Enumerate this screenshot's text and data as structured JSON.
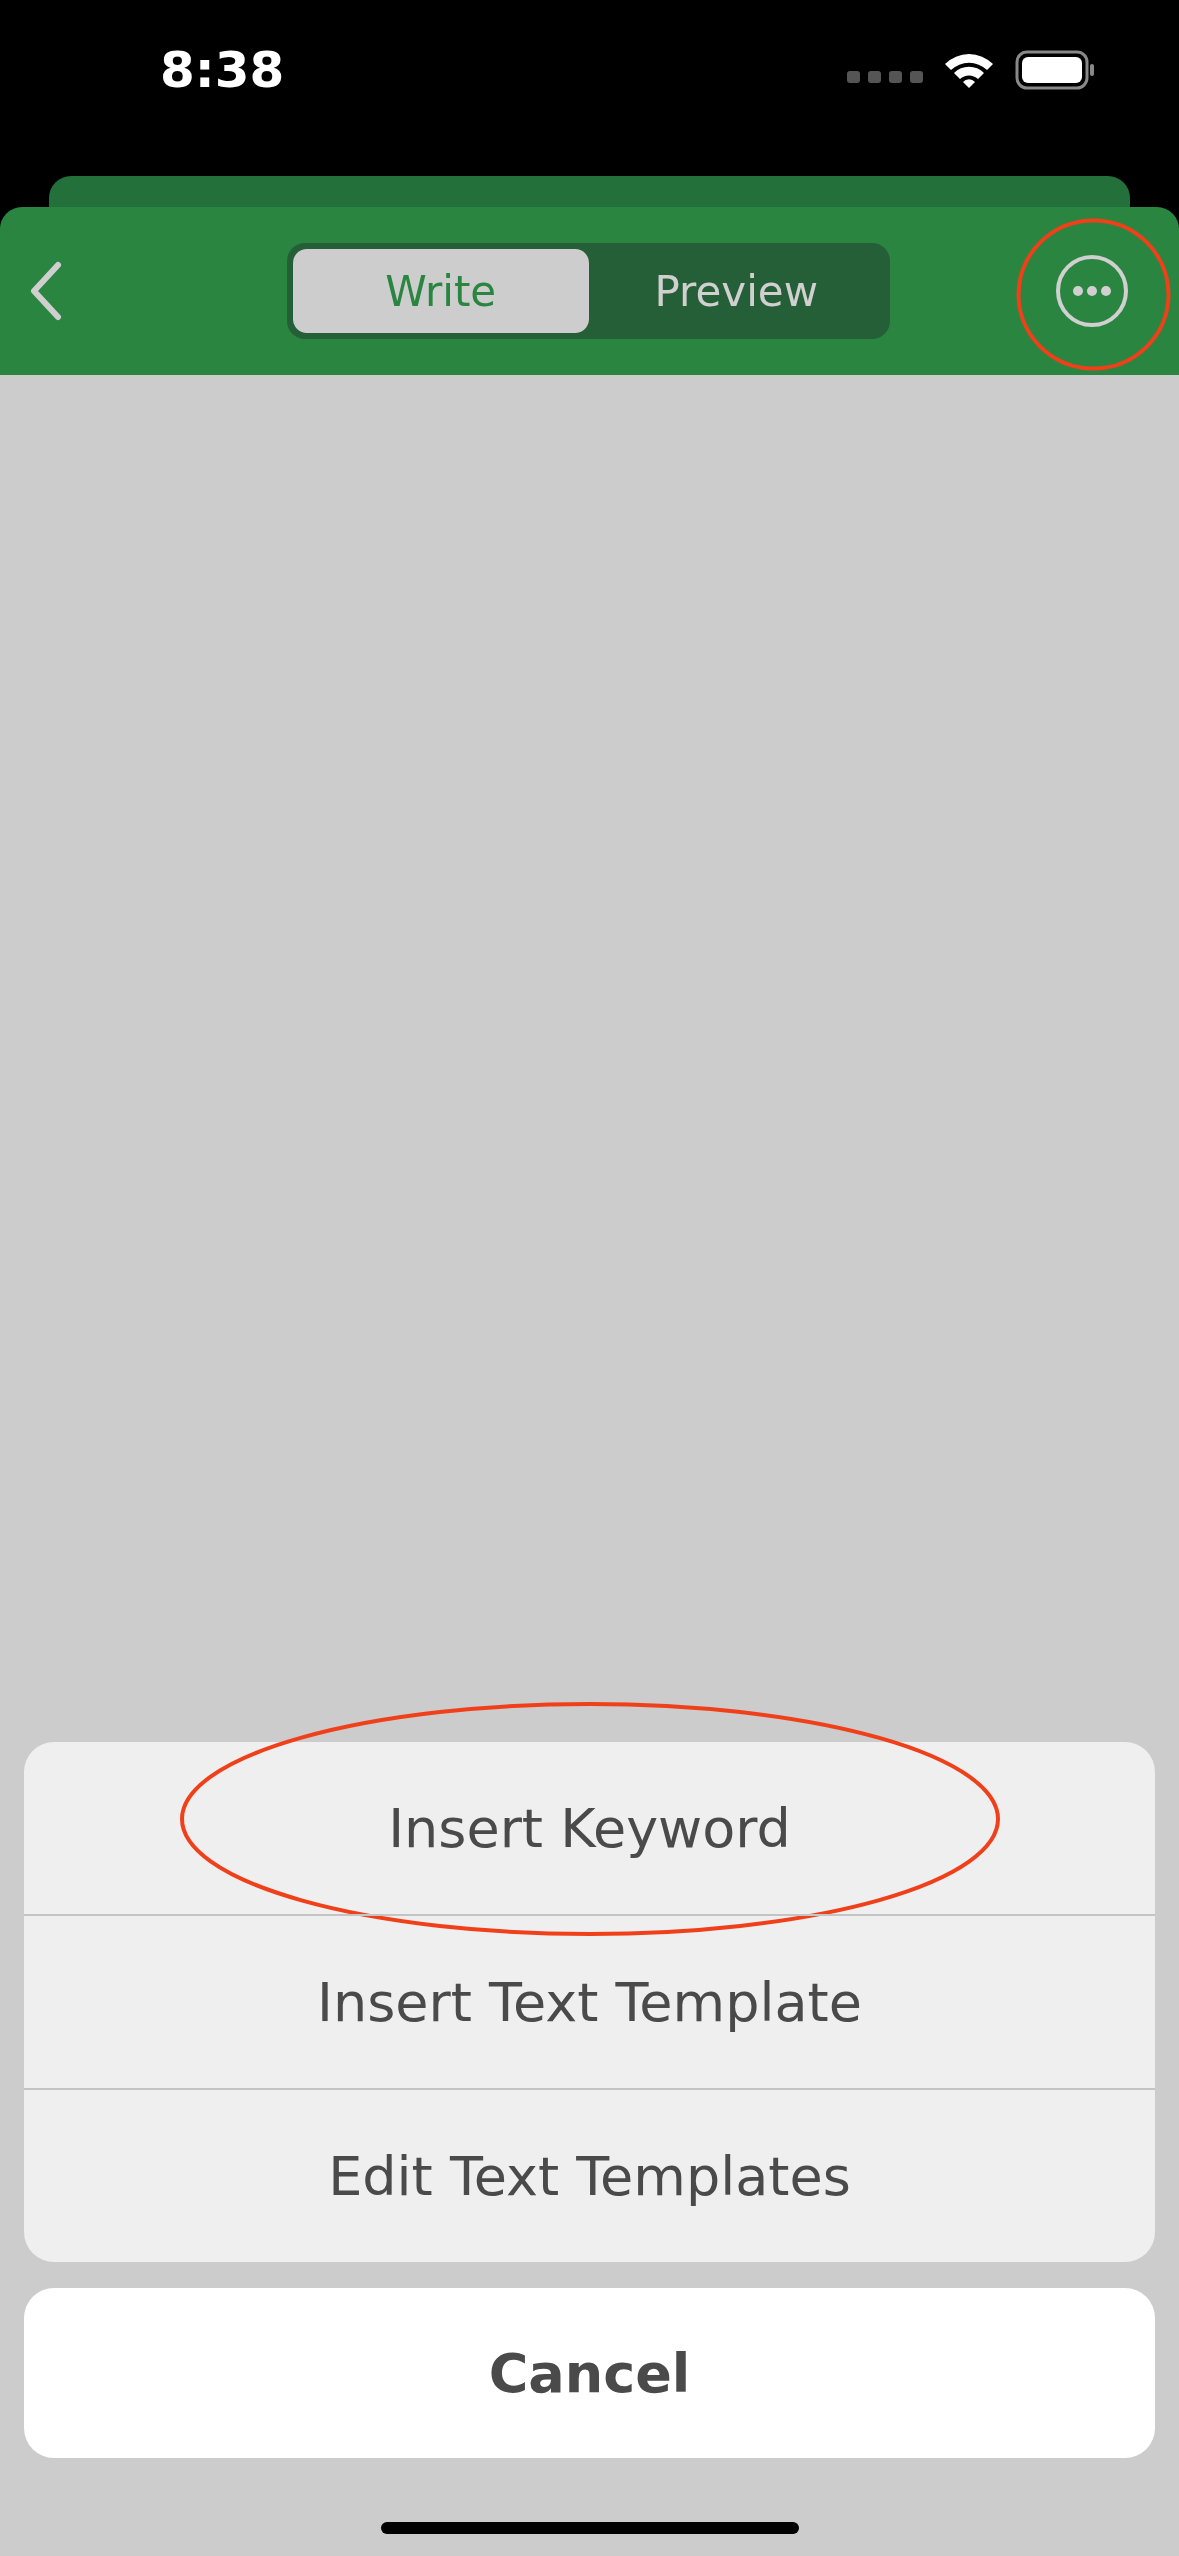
{
  "status_bar": {
    "time": "8:38"
  },
  "header": {
    "segments": [
      {
        "label": "Write",
        "selected": true
      },
      {
        "label": "Preview",
        "selected": false
      }
    ],
    "more_button": {
      "circled": true
    }
  },
  "action_sheet": {
    "items": [
      {
        "label": "Insert Keyword",
        "circled": true
      },
      {
        "label": "Insert Text Template",
        "circled": false
      },
      {
        "label": "Edit Text Templates",
        "circled": false
      }
    ],
    "cancel": "Cancel"
  }
}
